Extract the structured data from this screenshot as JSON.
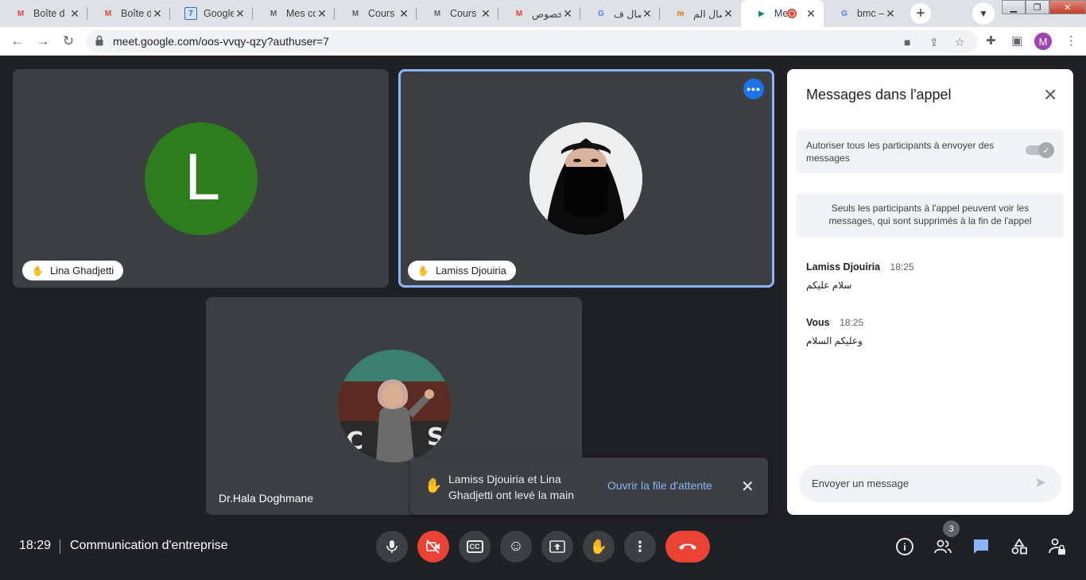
{
  "browser": {
    "tabs": [
      {
        "title": "Boîte d",
        "favicon": "gmail-icon",
        "letter": "M",
        "color": "#ea4335"
      },
      {
        "title": "Boîte d",
        "favicon": "gmail-icon",
        "letter": "M",
        "color": "#ea4335"
      },
      {
        "title": "Google",
        "favicon": "google-calendar-icon",
        "letter": "7",
        "color": "#1a73e8"
      },
      {
        "title": "Mes co",
        "favicon": "moodle-icon",
        "letter": "M",
        "color": "#5f6368"
      },
      {
        "title": "Cours :",
        "favicon": "moodle-icon",
        "letter": "M",
        "color": "#5f6368"
      },
      {
        "title": "Cours :",
        "favicon": "moodle-icon",
        "letter": "M",
        "color": "#5f6368"
      },
      {
        "title": "بخصوص",
        "favicon": "gmail-icon",
        "letter": "M",
        "color": "#ea4335"
      },
      {
        "title": "الاتصال ف",
        "favicon": "google-icon",
        "letter": "G",
        "color": "#4285f4"
      },
      {
        "title": "اتصال الم",
        "favicon": "site-icon",
        "letter": "m",
        "color": "#e37400"
      },
      {
        "title": "Me",
        "favicon": "google-meet-icon",
        "letter": "▶",
        "color": "#00897b",
        "recording": true
      },
      {
        "title": "bmc – ",
        "favicon": "google-icon",
        "letter": "G",
        "color": "#4285f4"
      }
    ],
    "url": "meet.google.com/oos-vvqy-qzy?authuser=7",
    "profile_initial": "M"
  },
  "stage": {
    "participants": [
      {
        "name": "Lina Ghadjetti",
        "avatar_letter": "L",
        "hand_raised": true
      },
      {
        "name": "Lamiss Djouiria",
        "hand_raised": true,
        "speaking": true
      },
      {
        "name": "Dr.Hala Doghmane",
        "hand_raised": false
      }
    ],
    "toast": {
      "message": "Lamiss Djouiria et Lina Ghadjetti ont levé la main",
      "link": "Ouvrir la file d'attente"
    }
  },
  "panel": {
    "title": "Messages dans l'appel",
    "setting_label": "Autoriser tous les participants à envoyer des messages",
    "notice": "Seuls les participants à l'appel peuvent voir les messages, qui sont supprimés à la fin de l'appel",
    "messages": [
      {
        "sender": "Lamiss Djouiria",
        "time": "18:25",
        "text": "سلام عليكم"
      },
      {
        "sender": "Vous",
        "time": "18:25",
        "text": "وعليكم السلام"
      }
    ],
    "composer_placeholder": "Envoyer un message"
  },
  "bottombar": {
    "time": "18:29",
    "meeting_name": "Communication d'entreprise",
    "people_count": "3"
  },
  "colors": {
    "stage_bg": "#202124",
    "tile_bg": "#3c4043",
    "accent_blue": "#8ab4f8",
    "danger_red": "#ea4335",
    "avatar_green": "#2d7d1e"
  }
}
